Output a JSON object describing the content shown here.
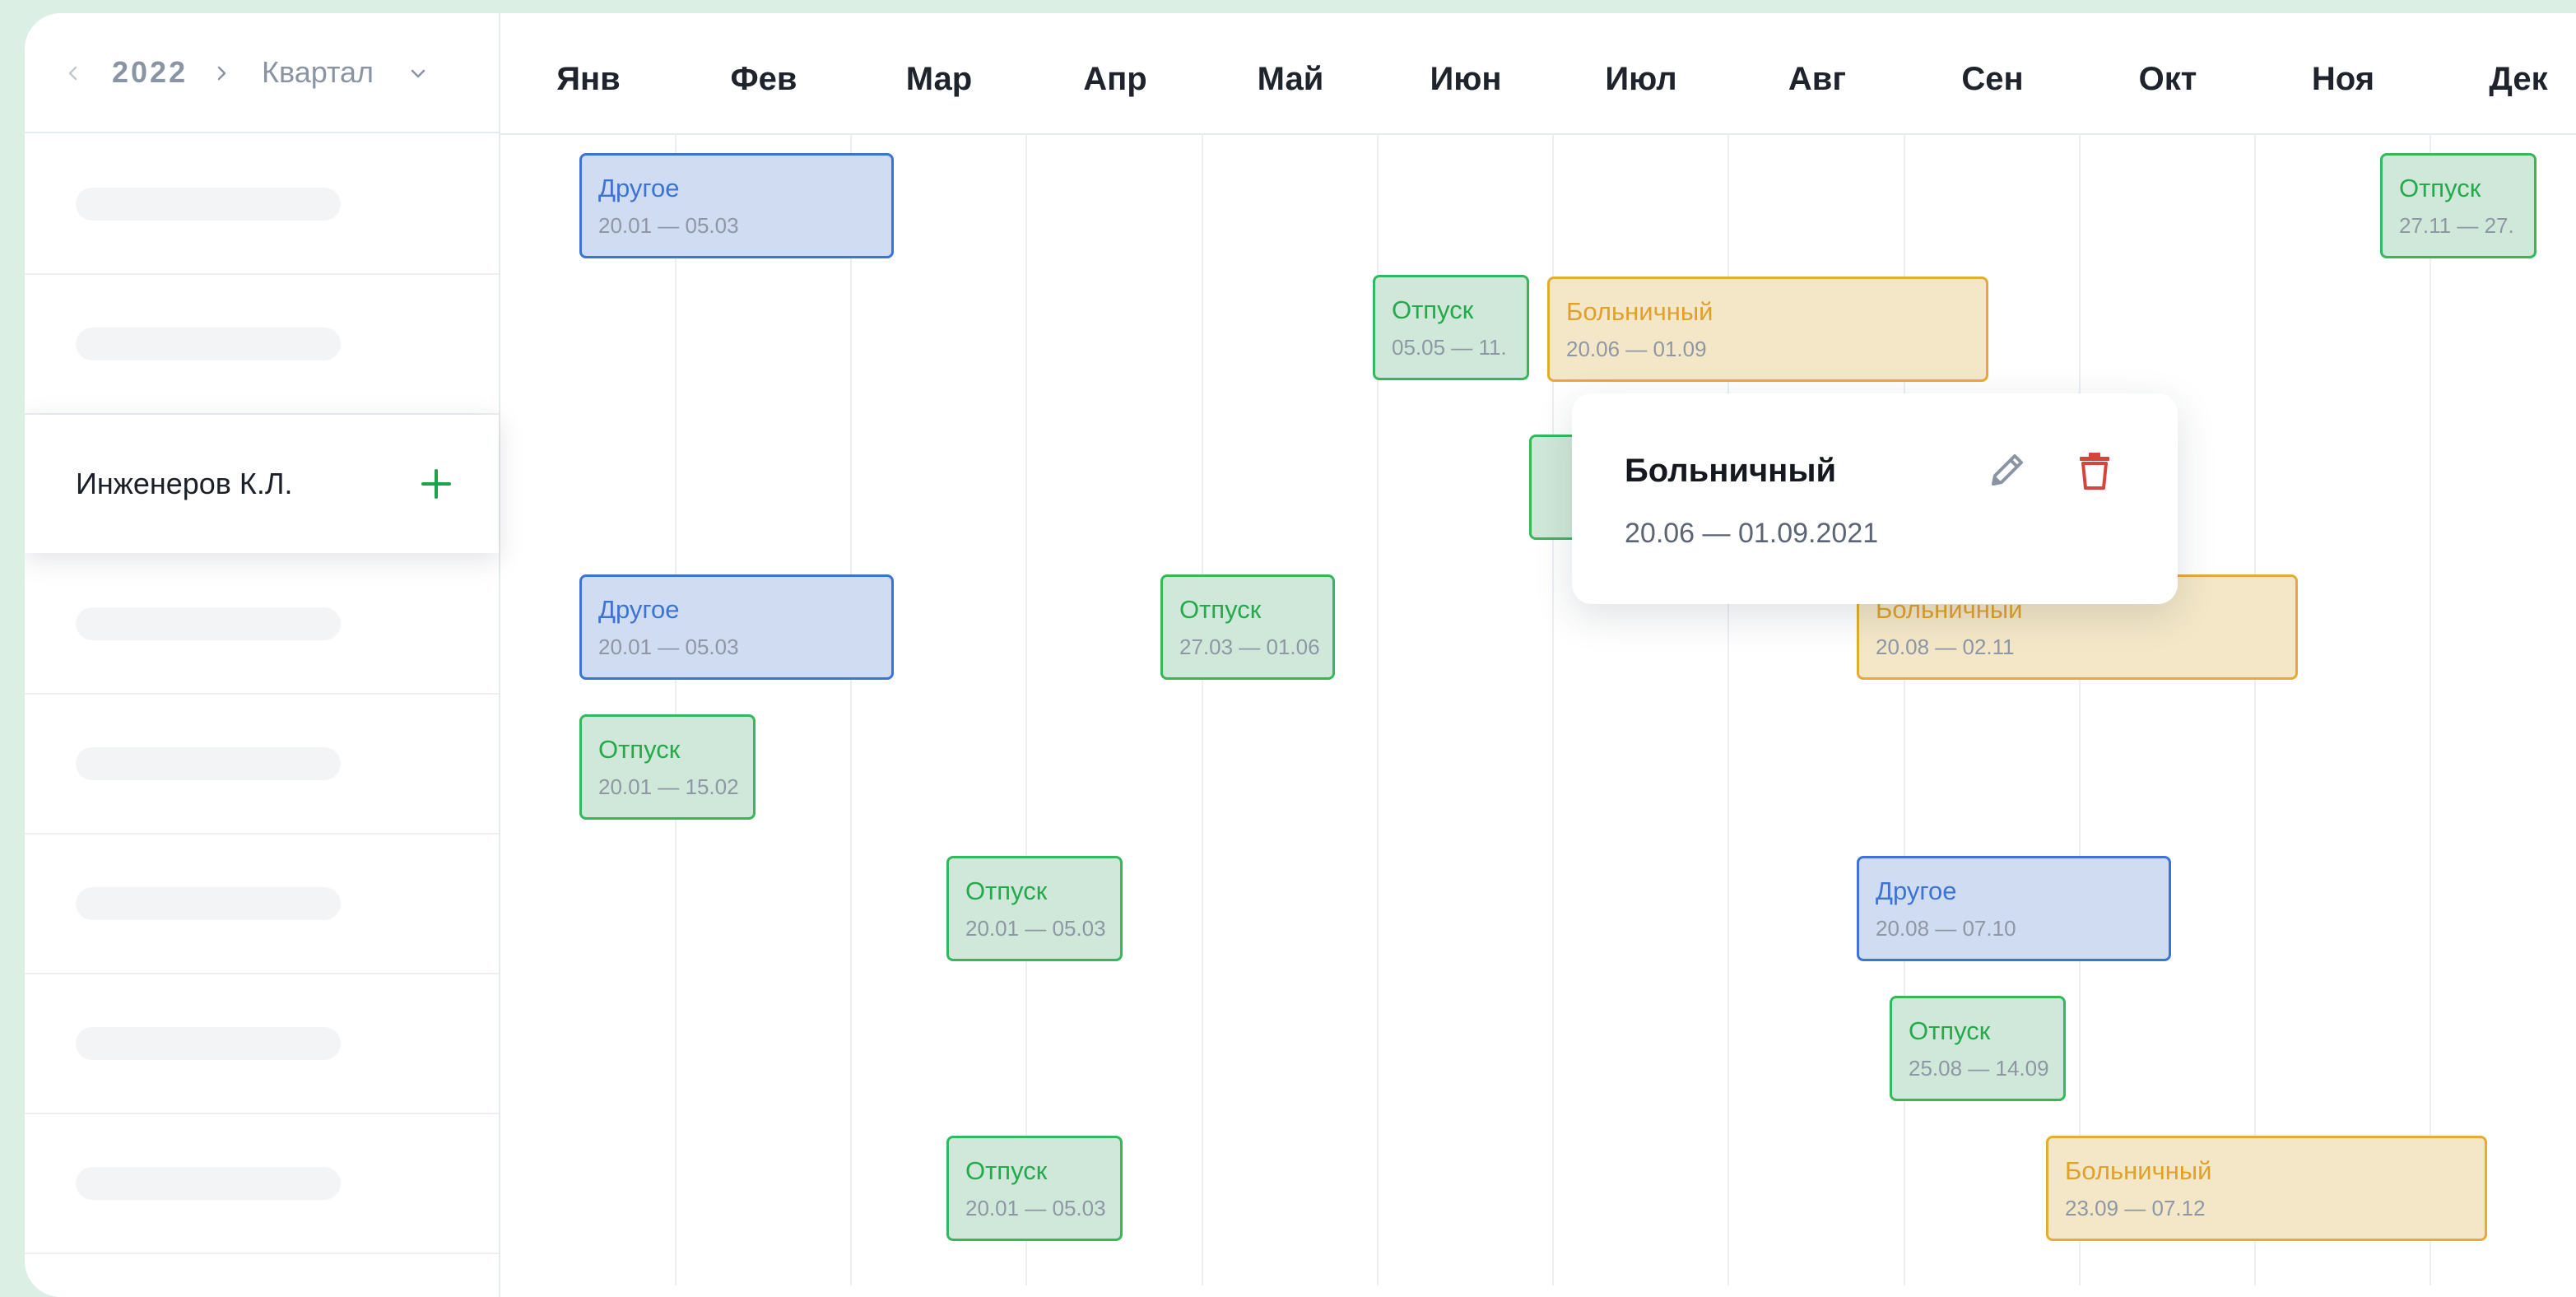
{
  "header": {
    "year": "2022",
    "period": "Квартал",
    "months": [
      "Янв",
      "Фев",
      "Мар",
      "Апр",
      "Май",
      "Июн",
      "Июл",
      "Авг",
      "Сен",
      "Окт",
      "Ноя",
      "Дек"
    ]
  },
  "sidebar": {
    "active_employee": "Инженеров К.Л."
  },
  "events": [
    {
      "type": "Другое",
      "dates": "20.01 — 05.03"
    },
    {
      "type": "Отпуск",
      "dates": "27.11 — 27."
    },
    {
      "type": "Отпуск",
      "dates": "05.05 — 11."
    },
    {
      "type": "Больничный",
      "dates": "20.06 — 01.09"
    },
    {
      "type": "Другое",
      "dates": "20.01 — 05.03"
    },
    {
      "type": "Отпуск",
      "dates": "27.03 — 01.06"
    },
    {
      "type": "Больничный",
      "dates": "20.08 — 02.11"
    },
    {
      "type": "Отпуск",
      "dates": "20.01 — 15.02"
    },
    {
      "type": "Отпуск",
      "dates": "20.01 — 05.03"
    },
    {
      "type": "Другое",
      "dates": "20.08 — 07.10"
    },
    {
      "type": "Отпуск",
      "dates": "25.08 — 14.09"
    },
    {
      "type": "Отпуск",
      "dates": "20.01 — 05.03"
    },
    {
      "type": "Больничный",
      "dates": "23.09 — 07.12"
    }
  ],
  "popover": {
    "title": "Больничный",
    "dates": "20.06 — 01.09.2021",
    "edit_icon": "pencil-icon",
    "delete_icon": "trash-icon"
  },
  "colors": {
    "other": "#3b74d6",
    "vacation": "#34b85c",
    "sick": "#e5ab34",
    "add_button": "#1aa34a",
    "delete": "#d6453a"
  }
}
